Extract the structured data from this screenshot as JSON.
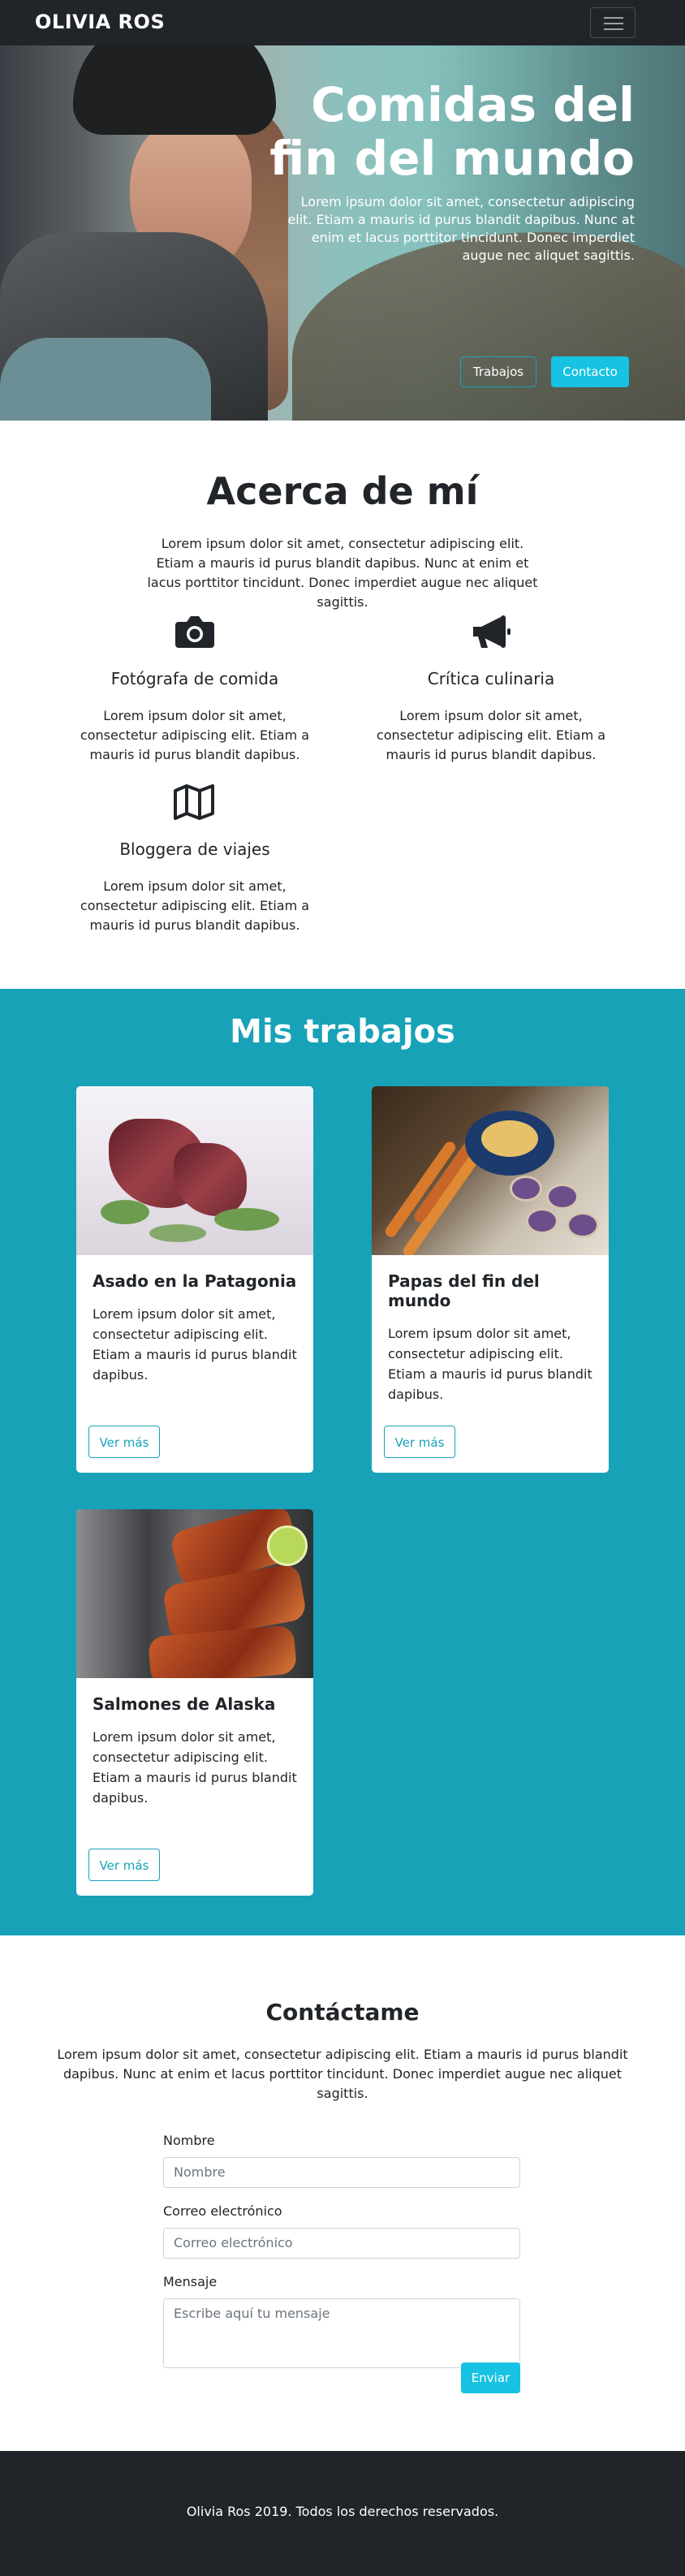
{
  "nav": {
    "brand": "OLIVIA ROS",
    "toggle_icon": "hamburger-menu-icon"
  },
  "hero": {
    "title": "Comidas del fin del mundo",
    "subtitle": "Lorem ipsum dolor sit amet, consectetur adipiscing elit. Etiam a mauris id purus blandit dapibus. Nunc at enim et lacus porttitor tincidunt. Donec imperdiet augue nec aliquet sagittis.",
    "btn_works": "Trabajos",
    "btn_contact": "Contacto"
  },
  "about": {
    "title": "Acerca de mí",
    "intro": "Lorem ipsum dolor sit amet, consectetur adipiscing elit. Etiam a mauris id purus blandit dapibus. Nunc at enim et lacus porttitor tincidunt. Donec imperdiet augue nec aliquet sagittis.",
    "features": [
      {
        "icon": "camera-icon",
        "title": "Fotógrafa de comida",
        "text": "Lorem ipsum dolor sit amet, consectetur adipiscing elit. Etiam a mauris id purus blandit dapibus."
      },
      {
        "icon": "megaphone-icon",
        "title": "Crítica culinaria",
        "text": "Lorem ipsum dolor sit amet, consectetur adipiscing elit. Etiam a mauris id purus blandit dapibus."
      },
      {
        "icon": "map-icon",
        "title": "Bloggera de viajes",
        "text": "Lorem ipsum dolor sit amet, consectetur adipiscing elit. Etiam a mauris id purus blandit dapibus."
      }
    ]
  },
  "works": {
    "title": "Mis trabajos",
    "cards": [
      {
        "title": "Asado en la Patagonia",
        "text": "Lorem ipsum dolor sit amet, consectetur adipiscing elit. Etiam a mauris id purus blandit dapibus.",
        "button": "Ver más"
      },
      {
        "title": "Papas del fin del mundo",
        "text": "Lorem ipsum dolor sit amet, consectetur adipiscing elit. Etiam a mauris id purus blandit dapibus.",
        "button": "Ver más"
      },
      {
        "title": "Salmones de Alaska",
        "text": "Lorem ipsum dolor sit amet, consectetur adipiscing elit. Etiam a mauris id purus blandit dapibus.",
        "button": "Ver más"
      }
    ]
  },
  "contact": {
    "title": "Contáctame",
    "intro": "Lorem ipsum dolor sit amet, consectetur adipiscing elit. Etiam a mauris id purus blandit dapibus. Nunc at enim et lacus porttitor tincidunt. Donec imperdiet augue nec aliquet sagittis.",
    "name_label": "Nombre",
    "name_placeholder": "Nombre",
    "email_label": "Correo electrónico",
    "email_placeholder": "Correo electrónico",
    "message_label": "Mensaje",
    "message_placeholder": "Escribe aquí tu mensaje",
    "submit": "Enviar"
  },
  "footer": {
    "text": "Olivia Ros 2019. Todos los derechos reservados."
  },
  "colors": {
    "dark": "#212529",
    "teal": "#17a2b8",
    "cyan_button": "#17c2e2"
  }
}
